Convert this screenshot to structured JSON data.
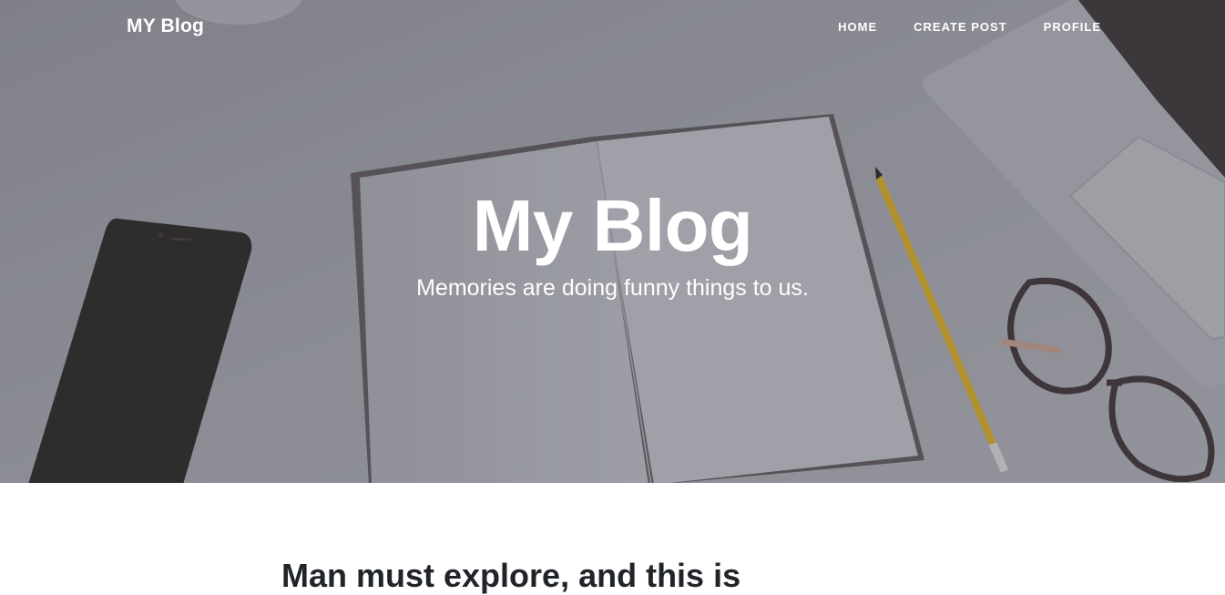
{
  "nav": {
    "brand": "MY Blog",
    "items": [
      {
        "label": "HOME"
      },
      {
        "label": "CREATE POST"
      },
      {
        "label": "PROFILE"
      }
    ]
  },
  "hero": {
    "heading": "My Blog",
    "subheading": "Memories are doing funny things to us."
  },
  "main": {
    "post_title": "Man must explore, and this is"
  },
  "colors": {
    "hero_background": "#8a8b93",
    "text_dark": "#212529",
    "text_light": "#ffffff"
  }
}
